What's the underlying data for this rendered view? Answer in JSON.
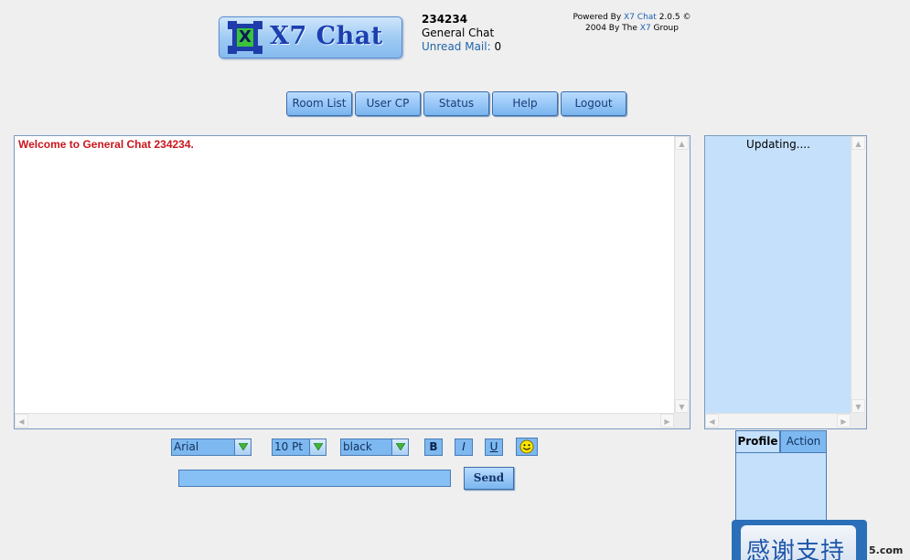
{
  "logo": {
    "text": "X7 Chat",
    "mark": "X"
  },
  "user": {
    "name": "234234",
    "room": "General Chat",
    "unread_mail_label": "Unread Mail:",
    "unread_mail_count": "0"
  },
  "powered": {
    "line1_prefix": "Powered By ",
    "line1_link": "X7 Chat",
    "line1_suffix": " 2.0.5 ©",
    "line2_prefix": "2004 By The ",
    "line2_link": "X7",
    "line2_suffix": " Group"
  },
  "nav": {
    "room_list": "Room List",
    "user_cp": "User CP",
    "status": "Status",
    "help": "Help",
    "logout": "Logout"
  },
  "chat": {
    "welcome": "Welcome to General Chat 234234."
  },
  "userlist": {
    "status": "Updating...."
  },
  "toolbar": {
    "font": "Arial",
    "size": "10 Pt",
    "color": "black",
    "bold": "B",
    "italic": "I",
    "underline": "U",
    "smiley_icon": "smiley-icon"
  },
  "message": {
    "input_value": "",
    "send_label": "Send"
  },
  "tabs": {
    "profile": "Profile",
    "action": "Action"
  },
  "banner": {
    "text": "感谢支持",
    "domain_fragment": "5.com"
  },
  "colors": {
    "welcome_text": "#c8161d",
    "panel_bg": "#c4e0fb",
    "control_bg": "#7db9f0"
  }
}
